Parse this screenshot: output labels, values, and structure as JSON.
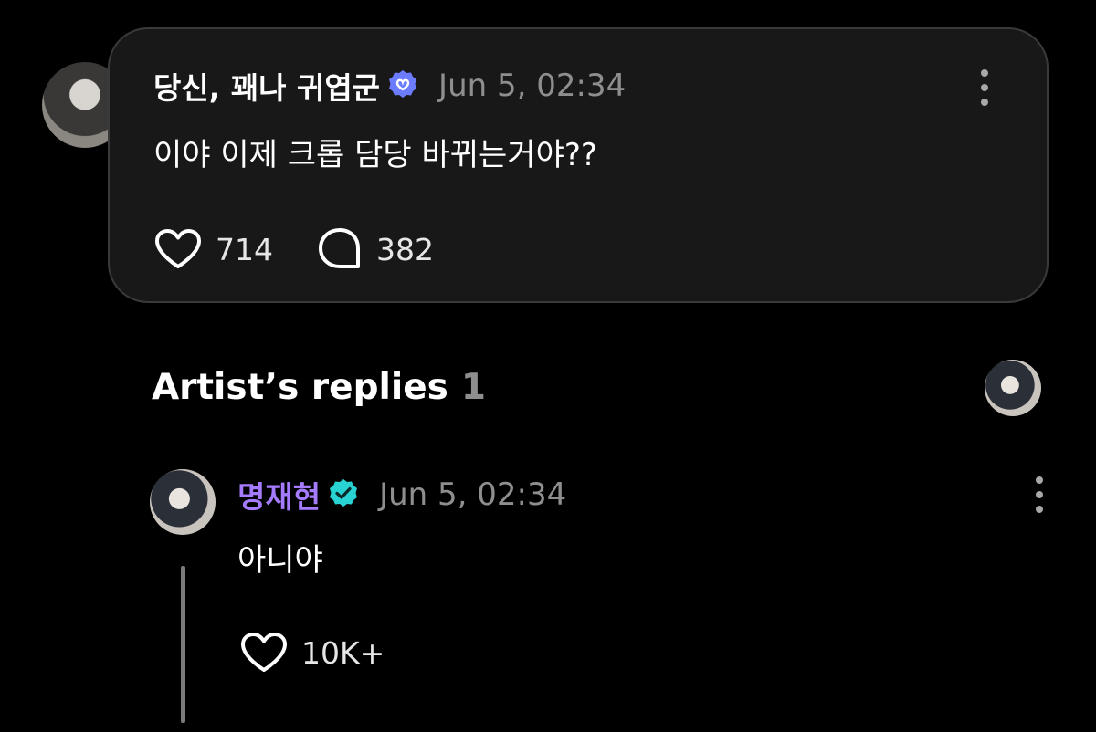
{
  "post": {
    "author": "당신, 꽤나 귀엽군",
    "timestamp": "Jun 5, 02:34",
    "text": "이야 이제 크롭 담당 바뀌는거야??",
    "likes": "714",
    "comments": "382",
    "badge_color": "#6b7cff"
  },
  "replies_section": {
    "title": "Artist’s replies",
    "count": "1"
  },
  "reply": {
    "author": "명재현",
    "author_color": "#a57bff",
    "timestamp": "Jun 5, 02:34",
    "text": "아니야",
    "likes": "10K+",
    "badge_color": "#29d3d3"
  },
  "icons": [
    "verified-badge-icon",
    "more-icon",
    "heart-icon",
    "comment-icon"
  ]
}
